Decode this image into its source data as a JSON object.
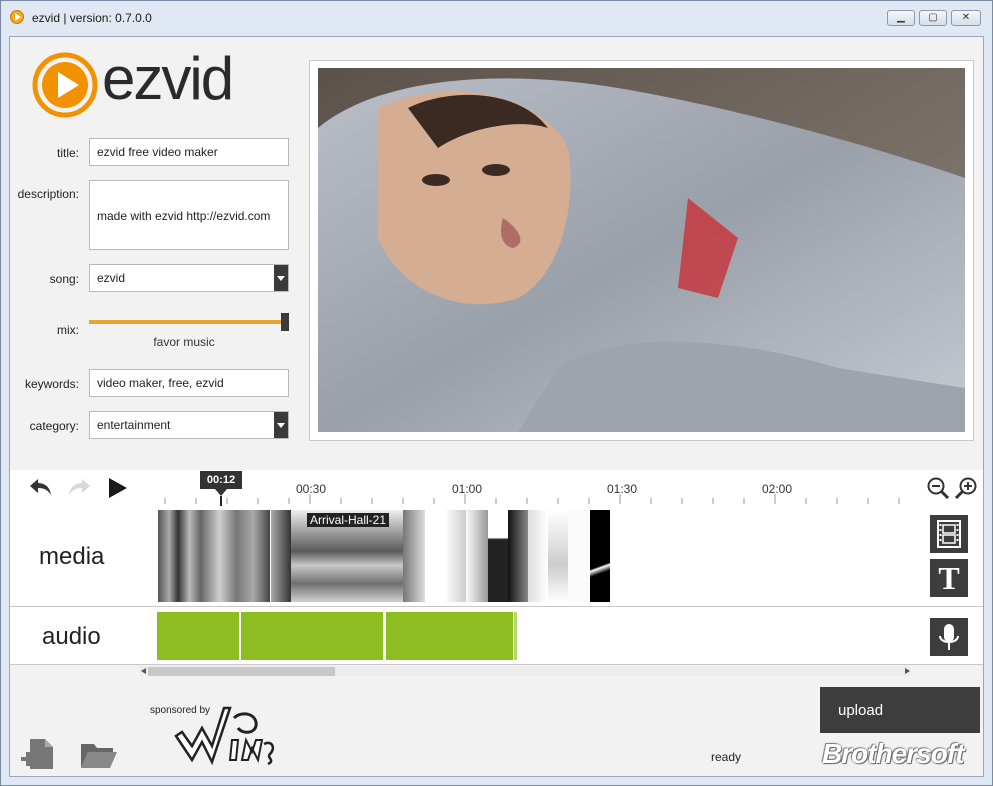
{
  "window": {
    "title": "ezvid | version: 0.7.0.0",
    "controls": {
      "minimize": "▁",
      "maximize": "▢",
      "close": "✕"
    }
  },
  "logo": {
    "text": "ezvid",
    "brand_color": "#f39200"
  },
  "form": {
    "title_label": "title:",
    "title_value": "ezvid free video maker",
    "description_label": "description:",
    "description_value": "made with ezvid http://ezvid.com",
    "song_label": "song:",
    "song_value": "ezvid",
    "mix_label": "mix:",
    "mix_caption": "favor music",
    "mix_level": 1.0,
    "keywords_label": "keywords:",
    "keywords_value": "video maker, free, ezvid",
    "category_label": "category:",
    "category_value": "entertainment"
  },
  "timeline": {
    "playhead_time": "00:12",
    "ticks": [
      "00:30",
      "01:00",
      "01:30",
      "02:00"
    ],
    "media_label": "media",
    "audio_label": "audio",
    "clip_caption": "Arrival-Hall-21",
    "audio_color": "#8cbd21",
    "tools": {
      "undo": "undo-icon",
      "redo": "redo-icon",
      "play": "play-icon",
      "zoom_out": "zoom-out-icon",
      "zoom_in": "zoom-in-icon",
      "film": "film-icon",
      "text": "T",
      "mic": "microphone-icon"
    }
  },
  "footer": {
    "sponsored_label": "sponsored by",
    "sponsor_logo": "Wings",
    "status": "ready",
    "upload_label": "upload",
    "watermark": "Brothersoft"
  }
}
